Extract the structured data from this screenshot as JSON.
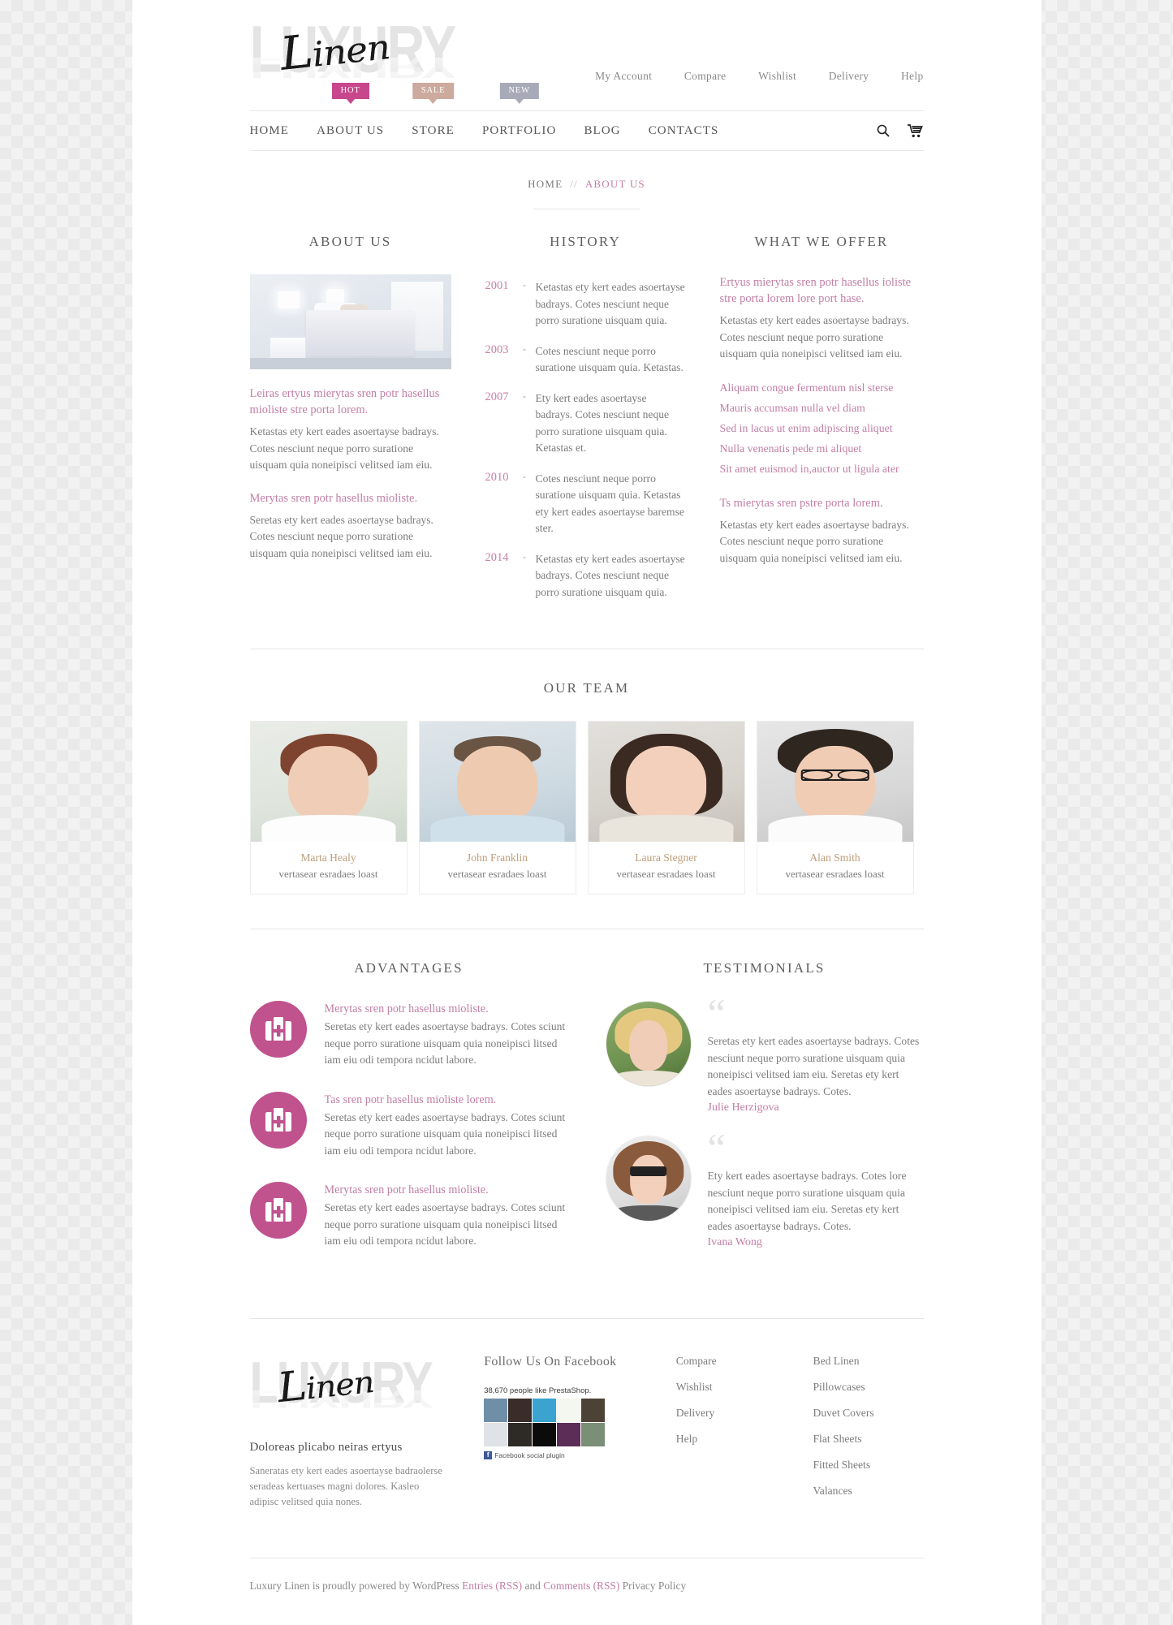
{
  "brand": {
    "word_back": "LUXURY",
    "script": "Linen",
    "script_cap": "L",
    "script_rest": "inen"
  },
  "topnav": {
    "items": [
      {
        "label": "My Account"
      },
      {
        "label": "Compare"
      },
      {
        "label": "Wishlist"
      },
      {
        "label": "Delivery"
      },
      {
        "label": "Help"
      }
    ]
  },
  "mainnav": {
    "items": [
      {
        "label": "HOME",
        "badge": null
      },
      {
        "label": "ABOUT US",
        "badge": "HOT",
        "badge_kind": "hot"
      },
      {
        "label": "STORE",
        "badge": "SALE",
        "badge_kind": "sale"
      },
      {
        "label": "PORTFOLIO",
        "badge": "NEW",
        "badge_kind": "new"
      },
      {
        "label": "BLOG",
        "badge": null
      },
      {
        "label": "CONTACTS",
        "badge": null
      }
    ],
    "search_icon": "search-icon",
    "cart_icon": "cart-icon"
  },
  "breadcrumb": {
    "home": "HOME",
    "separator": "//",
    "current": "ABOUT US"
  },
  "sections": {
    "about_title": "ABOUT US",
    "history_title": "HISTORY",
    "offer_title": "WHAT WE OFFER",
    "team_title": "OUR TEAM",
    "advantages_title": "ADVANTAGES",
    "testimonials_title": "TESTIMONIALS"
  },
  "about": {
    "image_alt": "bedroom-photo",
    "lead1": "Leiras ertyus mierytas sren potr hasellus mioliste stre porta lorem.",
    "body1": "Ketastas ety kert eades asoertayse badrays. Cotes nesciunt neque porro suratione uisquam quia noneipisci velitsed iam eiu.",
    "lead2": "Merytas sren potr hasellus mioliste.",
    "body2": "Seretas ety kert eades asoertayse badrays. Cotes nesciunt neque porro suratione uisquam quia noneipisci velitsed iam eiu."
  },
  "history": {
    "dash": "-",
    "entries": [
      {
        "year": "2001",
        "text": "Ketastas ety kert eades asoertayse badrays. Cotes nesciunt neque porro suratione uisquam quia."
      },
      {
        "year": "2003",
        "text": "Cotes nesciunt neque porro suratione uisquam quia. Ketastas."
      },
      {
        "year": "2007",
        "text": "Ety kert eades asoertayse badrays. Cotes nesciunt neque porro suratione uisquam quia. Ketastas et."
      },
      {
        "year": "2010",
        "text": "Cotes nesciunt neque porro suratione uisquam quia. Ketastas ety kert eades asoertayse baremse ster."
      },
      {
        "year": "2014",
        "text": "Ketastas ety kert eades asoertayse badrays. Cotes nesciunt neque porro suratione uisquam quia."
      }
    ]
  },
  "offer": {
    "lead1": "Ertyus mierytas sren potr hasellus ioliste stre porta lorem lore port hase.",
    "body1": "Ketastas ety kert eades asoertayse badrays. Cotes nesciunt neque porro suratione uisquam quia noneipisci velitsed iam eiu.",
    "list": [
      "Aliquam congue fermentum nisl sterse",
      "Mauris accumsan nulla vel diam",
      "Sed in lacus ut enim adipiscing aliquet",
      "Nulla venenatis pede mi aliquet",
      "Sit amet euismod in,auctor ut ligula ater"
    ],
    "lead2": "Ts mierytas sren pstre porta lorem.",
    "body2": "Ketastas ety kert eades asoertayse badrays. Cotes nesciunt neque porro suratione uisquam quia noneipisci velitsed iam eiu."
  },
  "team": {
    "members": [
      {
        "name": "Marta Healy",
        "role": "vertasear esradaes loast"
      },
      {
        "name": "John Franklin",
        "role": "vertasear esradaes loast"
      },
      {
        "name": "Laura Stegner",
        "role": "vertasear esradaes loast"
      },
      {
        "name": "Alan Smith",
        "role": "vertasear esradaes loast"
      }
    ]
  },
  "advantages": {
    "icon": "first-aid-kit-icon",
    "accent": "#c0528e",
    "items": [
      {
        "title": "Merytas sren potr hasellus mioliste.",
        "text": "Seretas ety kert eades asoertayse badrays. Cotes sciunt neque porro suratione uisquam quia noneipisci litsed iam eiu odi tempora ncidut labore."
      },
      {
        "title": "Tas sren potr hasellus mioliste lorem.",
        "text": "Seretas ety kert eades asoertayse badrays. Cotes sciunt neque porro suratione uisquam quia noneipisci litsed iam eiu odi tempora ncidut labore."
      },
      {
        "title": "Merytas sren potr hasellus mioliste.",
        "text": "Seretas ety kert eades asoertayse badrays. Cotes sciunt neque porro suratione uisquam quia noneipisci litsed iam eiu odi tempora ncidut labore."
      }
    ]
  },
  "testimonials": {
    "quote_mark": "“",
    "items": [
      {
        "text": "Seretas ety kert eades asoertayse badrays. Cotes nesciunt neque porro suratione uisquam quia noneipisci velitsed iam eiu. Seretas ety kert eades asoertayse badrays. Cotes.",
        "name": "Julie Herzigova"
      },
      {
        "text": "Ety kert eades asoertayse badrays. Cotes lore nesciunt neque porro suratione uisquam quia noneipisci velitsed iam eiu. Seretas ety kert eades asoertayse badrays. Cotes.",
        "name": "Ivana Wong"
      }
    ]
  },
  "footer": {
    "about_heading": "Doloreas plicabo neiras ertyus",
    "about_text": "Saneratas ety kert eades asoertayse badraolerse seradeas kertuases magni dolores. Kasleo adipisc velitsed quia nones.",
    "facebook_title": "Follow Us On Facebook",
    "facebook_likes": "38,670 people like PrestaShop.",
    "facebook_plugin": "Facebook social plugin",
    "facebook_badge": "f",
    "links_col1": [
      "Compare",
      "Wishlist",
      "Delivery",
      "Help"
    ],
    "links_col2": [
      "Bed Linen",
      "Pillowcases",
      "Duvet Covers",
      "Flat Sheets",
      "Fitted Sheets",
      "Valances"
    ],
    "copyright": {
      "part1": "Luxury Linen is proudly powered by WordPress ",
      "link1": "Entries (RSS)",
      "part2": " and ",
      "link2": "Comments (RSS)",
      "part3": " Privacy Policy"
    }
  }
}
